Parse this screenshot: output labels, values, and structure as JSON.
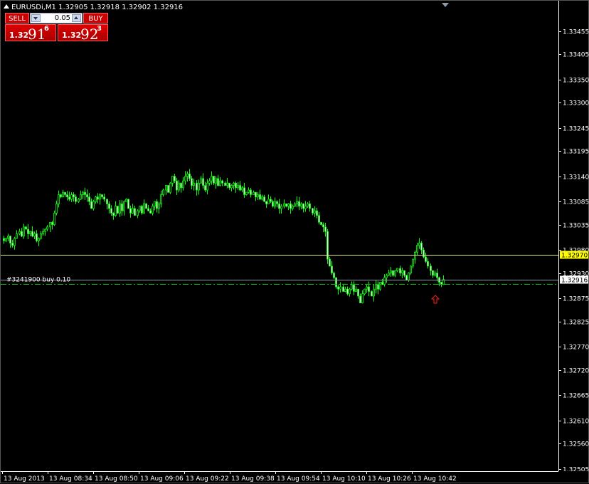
{
  "window": {
    "title": "EURUSDi,M1  1.32905 1.32918 1.32902 1.32916"
  },
  "trade_panel": {
    "sell_label": "SELL",
    "buy_label": "BUY",
    "lot_value": "0.05",
    "sell_price_small": "1.32",
    "sell_price_big": "91",
    "sell_price_sup": "6",
    "buy_price_small": "1.32",
    "buy_price_big": "92",
    "buy_price_sup": "3"
  },
  "order_line": {
    "label": "#3241900 buy 0.10",
    "price": 1.32906
  },
  "horizontal_line": {
    "price": 1.3297,
    "label": "1.32970"
  },
  "current_price": {
    "price": 1.32916,
    "label": "1.32916"
  },
  "chart_data": {
    "type": "candlestick",
    "symbol": "EURUSDi",
    "timeframe": "M1",
    "ylim": [
      1.325,
      1.3351
    ],
    "y_ticks": [
      "1.33455",
      "1.33405",
      "1.33350",
      "1.33300",
      "1.33245",
      "1.33195",
      "1.33140",
      "1.33085",
      "1.33035",
      "1.32980",
      "1.32930",
      "1.32875",
      "1.32825",
      "1.32770",
      "1.32720",
      "1.32665",
      "1.32610",
      "1.32560",
      "1.32505"
    ],
    "x_labels": [
      "13 Aug 2013",
      "13 Aug 08:34",
      "13 Aug 08:50",
      "13 Aug 09:06",
      "13 Aug 09:22",
      "13 Aug 09:38",
      "13 Aug 09:54",
      "13 Aug 10:10",
      "13 Aug 10:26",
      "13 Aug 10:42"
    ],
    "close": [
      1.33,
      1.33005,
      1.3301,
      1.32995,
      1.3299,
      1.33005,
      1.33015,
      1.3302,
      1.3301,
      1.3303,
      1.33025,
      1.33015,
      1.3302,
      1.3301,
      1.33015,
      1.33,
      1.33005,
      1.33015,
      1.3302,
      1.33025,
      1.3303,
      1.3304,
      1.33035,
      1.3306,
      1.3308,
      1.331,
      1.33095,
      1.33105,
      1.331,
      1.33095,
      1.3309,
      1.331,
      1.33095,
      1.33085,
      1.3309,
      1.331,
      1.33105,
      1.331,
      1.33095,
      1.33085,
      1.3307,
      1.33085,
      1.33095,
      1.3309,
      1.331,
      1.33095,
      1.3309,
      1.3308,
      1.3307,
      1.3306,
      1.33055,
      1.33075,
      1.3306,
      1.3308,
      1.33065,
      1.33085,
      1.3309,
      1.3307,
      1.3306,
      1.3307,
      1.33055,
      1.33065,
      1.33075,
      1.3306,
      1.3308,
      1.3307,
      1.33065,
      1.3306,
      1.33075,
      1.33085,
      1.3307,
      1.3308,
      1.331,
      1.3311,
      1.3312,
      1.33105,
      1.33125,
      1.3314,
      1.3313,
      1.3311,
      1.33125,
      1.33115,
      1.3313,
      1.3314,
      1.33145,
      1.33135,
      1.3312,
      1.33125,
      1.3311,
      1.33125,
      1.33135,
      1.3312,
      1.3311,
      1.33125,
      1.3313,
      1.3314,
      1.33125,
      1.33135,
      1.3312,
      1.3313,
      1.33125,
      1.3312,
      1.33125,
      1.33115,
      1.3312,
      1.33125,
      1.33115,
      1.3312,
      1.3311,
      1.33115,
      1.331,
      1.33105,
      1.3311,
      1.331,
      1.33105,
      1.33095,
      1.331,
      1.3309,
      1.33095,
      1.33085,
      1.3308,
      1.3309,
      1.33085,
      1.33075,
      1.33085,
      1.3308,
      1.3307,
      1.33075,
      1.3308,
      1.33075,
      1.3308,
      1.3307,
      1.33075,
      1.3308,
      1.33085,
      1.33075,
      1.3308,
      1.3307,
      1.33075,
      1.3308,
      1.3307,
      1.3306,
      1.33065,
      1.33055,
      1.3304,
      1.33035,
      1.3303,
      1.3302,
      1.3296,
      1.32945,
      1.3293,
      1.3292,
      1.329,
      1.32895,
      1.329,
      1.3289,
      1.32895,
      1.32885,
      1.32895,
      1.32905,
      1.3289,
      1.32895,
      1.3288,
      1.32865,
      1.32885,
      1.32895,
      1.329,
      1.3289,
      1.3288,
      1.32895,
      1.32905,
      1.32895,
      1.3291,
      1.32905,
      1.3292,
      1.32925,
      1.3293,
      1.32935,
      1.32925,
      1.32935,
      1.3294,
      1.3293,
      1.32935,
      1.32925,
      1.32915,
      1.3293,
      1.32945,
      1.3296,
      1.32975,
      1.3299,
      1.32995,
      1.3298,
      1.32965,
      1.32955,
      1.32945,
      1.32935,
      1.32925,
      1.3293,
      1.3292,
      1.3291,
      1.32905,
      1.32916
    ]
  }
}
